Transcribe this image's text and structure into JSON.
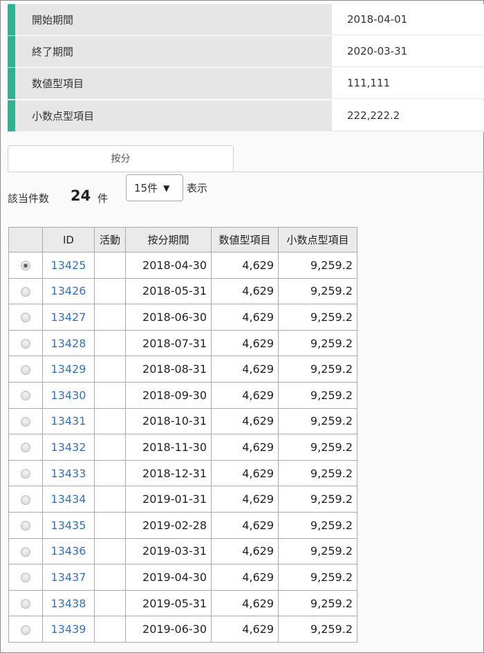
{
  "details": [
    {
      "label": "開始期間",
      "value": "2018-04-01"
    },
    {
      "label": "終了期間",
      "value": "2020-03-31"
    },
    {
      "label": "数値型項目",
      "value": "111,111"
    },
    {
      "label": "小数点型項目",
      "value": "222,222.2"
    }
  ],
  "tab": {
    "label": "按分"
  },
  "results": {
    "count_label": "該当件数",
    "count": "24",
    "count_unit": "件",
    "page_size": "15件",
    "page_size_suffix": "表示"
  },
  "grid": {
    "headers": [
      "",
      "ID",
      "活動",
      "按分期間",
      "数値型項目",
      "小数点型項目"
    ],
    "rows": [
      {
        "selected": true,
        "id": "13425",
        "activity": "",
        "period": "2018-04-30",
        "number": "4,629",
        "decimal": "9,259.2"
      },
      {
        "selected": false,
        "id": "13426",
        "activity": "",
        "period": "2018-05-31",
        "number": "4,629",
        "decimal": "9,259.2"
      },
      {
        "selected": false,
        "id": "13427",
        "activity": "",
        "period": "2018-06-30",
        "number": "4,629",
        "decimal": "9,259.2"
      },
      {
        "selected": false,
        "id": "13428",
        "activity": "",
        "period": "2018-07-31",
        "number": "4,629",
        "decimal": "9,259.2"
      },
      {
        "selected": false,
        "id": "13429",
        "activity": "",
        "period": "2018-08-31",
        "number": "4,629",
        "decimal": "9,259.2"
      },
      {
        "selected": false,
        "id": "13430",
        "activity": "",
        "period": "2018-09-30",
        "number": "4,629",
        "decimal": "9,259.2"
      },
      {
        "selected": false,
        "id": "13431",
        "activity": "",
        "period": "2018-10-31",
        "number": "4,629",
        "decimal": "9,259.2"
      },
      {
        "selected": false,
        "id": "13432",
        "activity": "",
        "period": "2018-11-30",
        "number": "4,629",
        "decimal": "9,259.2"
      },
      {
        "selected": false,
        "id": "13433",
        "activity": "",
        "period": "2018-12-31",
        "number": "4,629",
        "decimal": "9,259.2"
      },
      {
        "selected": false,
        "id": "13434",
        "activity": "",
        "period": "2019-01-31",
        "number": "4,629",
        "decimal": "9,259.2"
      },
      {
        "selected": false,
        "id": "13435",
        "activity": "",
        "period": "2019-02-28",
        "number": "4,629",
        "decimal": "9,259.2"
      },
      {
        "selected": false,
        "id": "13436",
        "activity": "",
        "period": "2019-03-31",
        "number": "4,629",
        "decimal": "9,259.2"
      },
      {
        "selected": false,
        "id": "13437",
        "activity": "",
        "period": "2019-04-30",
        "number": "4,629",
        "decimal": "9,259.2"
      },
      {
        "selected": false,
        "id": "13438",
        "activity": "",
        "period": "2019-05-31",
        "number": "4,629",
        "decimal": "9,259.2"
      },
      {
        "selected": false,
        "id": "13439",
        "activity": "",
        "period": "2019-06-30",
        "number": "4,629",
        "decimal": "9,259.2"
      }
    ]
  },
  "colors": {
    "accent": "#2bb393",
    "link": "#3573c0",
    "label_bg": "#e6e6e6",
    "header_bg": "#eaeaea"
  },
  "icons": {
    "dropdown": "caret-down-icon",
    "row_select": "radio-icon"
  }
}
